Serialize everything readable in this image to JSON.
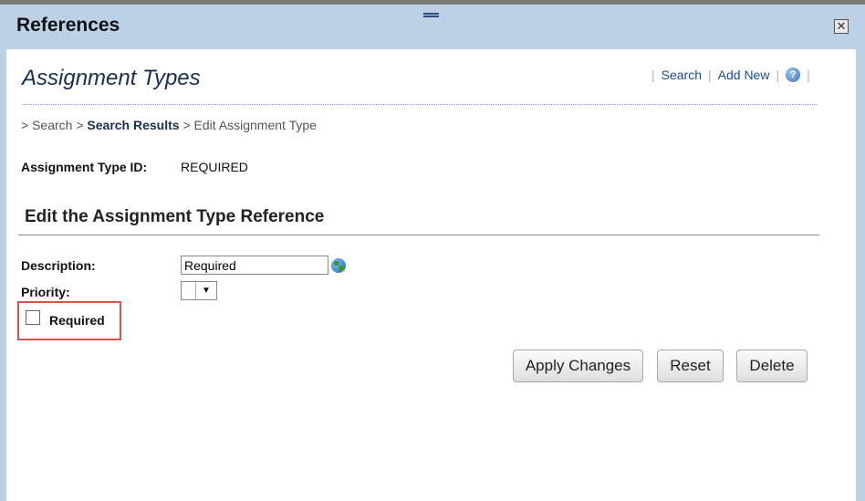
{
  "window": {
    "title": "References",
    "close_glyph": "✕"
  },
  "header": {
    "page_title": "Assignment Types",
    "links": {
      "search": "Search",
      "add_new": "Add New",
      "separator": "|"
    },
    "help_icon": "help-icon"
  },
  "breadcrumb": {
    "prefix1": "> ",
    "item1": "Search",
    "prefix2": " > ",
    "item2": "Search Results",
    "prefix3": " > ",
    "item3": "Edit Assignment Type"
  },
  "assignment": {
    "id_label": "Assignment Type ID:",
    "id_value": "REQUIRED"
  },
  "section": {
    "title": "Edit the Assignment Type Reference"
  },
  "form": {
    "description_label": "Description:",
    "description_value": "Required",
    "priority_label": "Priority:",
    "priority_value": "",
    "required_label": "Required",
    "required_checked": false
  },
  "buttons": {
    "apply": "Apply Changes",
    "reset": "Reset",
    "delete": "Delete"
  },
  "colors": {
    "highlight": "#d9534f",
    "chrome": "#bcd0e6",
    "title_blue": "#1a2e4f"
  }
}
